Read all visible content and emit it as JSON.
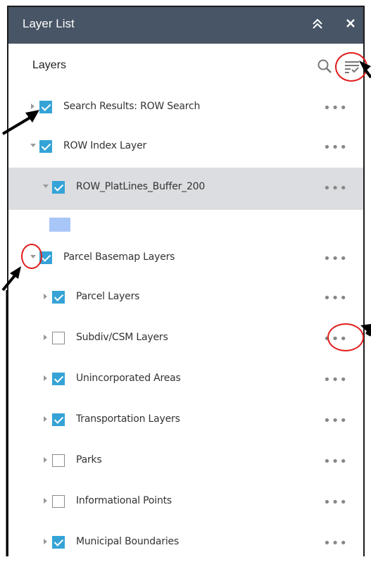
{
  "panel": {
    "title": "Layer List",
    "collapse_icon": "double-chevron-up-icon",
    "close_icon": "close-icon",
    "collapse_glyph": "≈",
    "close_glyph": "✕"
  },
  "layers_header": {
    "label": "Layers",
    "search_icon": "search-icon",
    "filter_icon": "filter-list-icon"
  },
  "layers": [
    {
      "label": "Search Results: ROW Search",
      "checked": true,
      "expander": "collapsed",
      "indent": 0
    },
    {
      "label": "ROW Index Layer",
      "checked": true,
      "expander": "expanded",
      "indent": 0
    },
    {
      "label": "ROW_PlatLines_Buffer_200",
      "checked": true,
      "expander": "expanded",
      "indent": 1,
      "highlighted": true
    },
    {
      "label": "Parcel Basemap Layers",
      "checked": true,
      "expander": "expanded",
      "indent": 0
    },
    {
      "label": "Parcel Layers",
      "checked": true,
      "expander": "collapsed",
      "indent": 1
    },
    {
      "label": "Subdiv/CSM Layers",
      "checked": false,
      "expander": "collapsed",
      "indent": 1
    },
    {
      "label": "Unincorporated Areas",
      "checked": true,
      "expander": "collapsed",
      "indent": 1
    },
    {
      "label": "Transportation Layers",
      "checked": true,
      "expander": "collapsed",
      "indent": 1
    },
    {
      "label": "Parks",
      "checked": false,
      "expander": "collapsed",
      "indent": 1
    },
    {
      "label": "Informational Points",
      "checked": false,
      "expander": "collapsed",
      "indent": 1
    },
    {
      "label": "Municipal Boundaries",
      "checked": true,
      "expander": "collapsed",
      "indent": 1
    }
  ],
  "more_glyph": "•••",
  "colors": {
    "titlebar": "#485566",
    "checkbox_on": "#35a3d6",
    "highlight_row": "#dcdde0",
    "legend_swatch": "#a9c6f8",
    "annotation_red": "#e21c1c"
  }
}
